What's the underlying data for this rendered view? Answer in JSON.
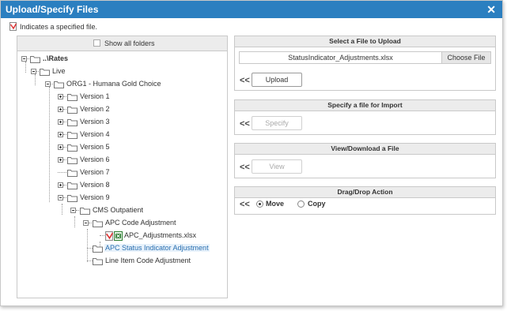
{
  "dialog": {
    "title": "Upload/Specify Files",
    "close_glyph": "✕",
    "legend_text": "Indicates a specified file.",
    "legend_icon": "specified-file-icon"
  },
  "tree": {
    "show_all_label": "Show all folders",
    "show_all_checked": false,
    "nodes": {
      "rates": "..\\Rates",
      "live": "Live",
      "org1": "ORG1 - Humana Gold Choice",
      "v1": "Version 1",
      "v2": "Version 2",
      "v3": "Version 3",
      "v4": "Version 4",
      "v5": "Version 5",
      "v6": "Version 6",
      "v7": "Version 7",
      "v8": "Version 8",
      "v9": "Version 9",
      "cms": "CMS Outpatient",
      "apc_code": "APC Code Adjustment",
      "apc_file": "APC_Adjustments.xlsx",
      "apc_status": "APC Status Indicator Adjustment",
      "line_item": "Line Item Code Adjustment"
    }
  },
  "upload": {
    "header": "Select a File to Upload",
    "file_name": "StatusIndicator_Adjustments.xlsx",
    "choose_label": "Choose File",
    "button_label": "Upload"
  },
  "specify": {
    "header": "Specify a file for Import",
    "button_label": "Specify"
  },
  "view": {
    "header": "View/Download a File",
    "button_label": "View"
  },
  "dragdrop": {
    "header": "Drag/Drop Action",
    "move_label": "Move",
    "copy_label": "Copy",
    "selected": "Move"
  },
  "chevron": "<<",
  "colors": {
    "titlebar": "#2b7fc0",
    "selected_text": "#2a6fb0"
  }
}
